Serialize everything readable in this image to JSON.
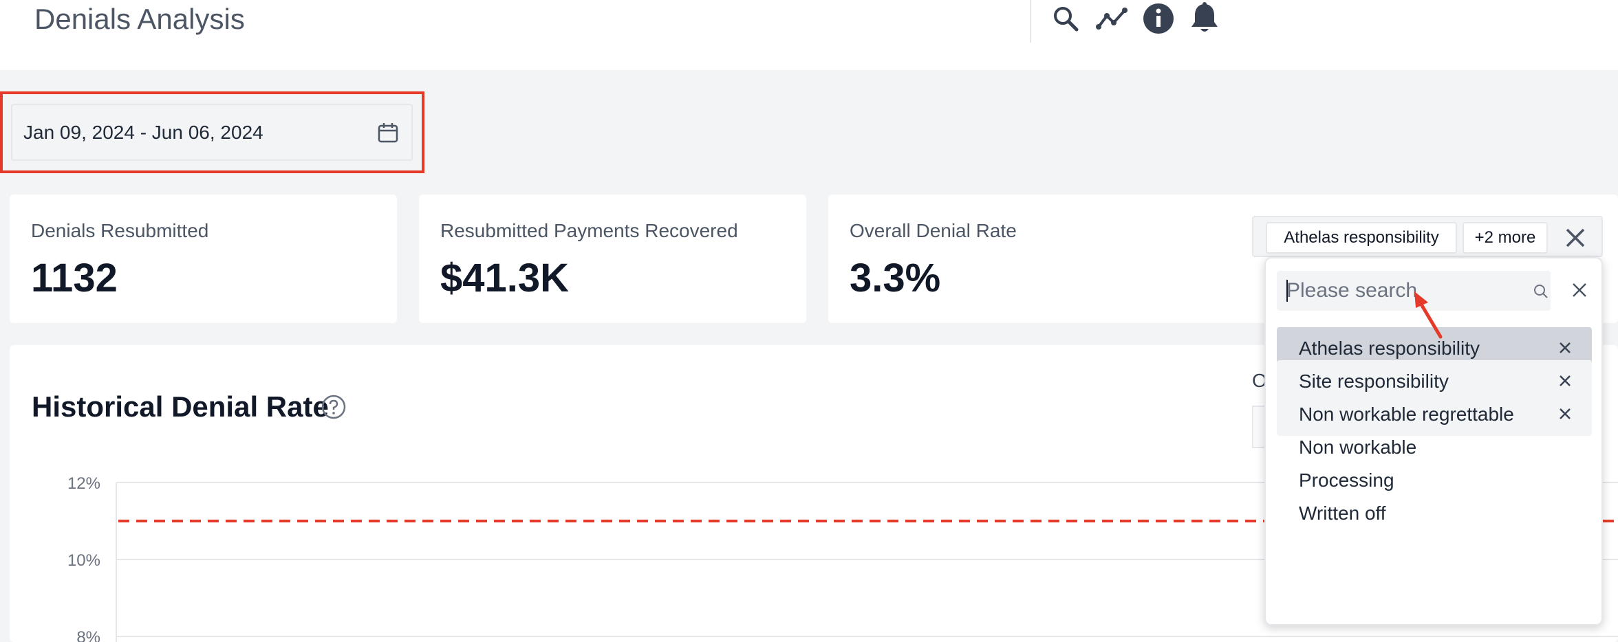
{
  "header": {
    "title": "Denials Analysis",
    "icons": [
      "search-icon",
      "trend-icon",
      "info-icon",
      "bell-icon"
    ]
  },
  "date_range": {
    "value": "Jan 09, 2024 - Jun 06, 2024"
  },
  "stats": [
    {
      "label": "Denials Resubmitted",
      "value": "1132"
    },
    {
      "label": "Resubmitted Payments Recovered",
      "value": "$41.3K"
    },
    {
      "label": "Overall Denial Rate",
      "value": "3.3%"
    }
  ],
  "filter": {
    "chips": [
      "Athelas responsibility",
      "+2 more"
    ],
    "search_placeholder": "Please search",
    "options": [
      {
        "label": "Athelas responsibility",
        "selected": true,
        "highlighted": true
      },
      {
        "label": "Site responsibility",
        "selected": true,
        "highlighted": false
      },
      {
        "label": "Non workable regrettable",
        "selected": true,
        "highlighted": false
      },
      {
        "label": "Non workable",
        "selected": false,
        "highlighted": false
      },
      {
        "label": "Processing",
        "selected": false,
        "highlighted": false
      },
      {
        "label": "Written off",
        "selected": false,
        "highlighted": false
      }
    ]
  },
  "panel": {
    "title": "Historical Denial Rate",
    "partial_label": "O"
  },
  "chart_data": {
    "type": "line",
    "title": "Historical Denial Rate",
    "y_ticks": [
      "12%",
      "10%",
      "8%"
    ],
    "ylim": [
      8,
      12
    ],
    "reference_line": {
      "value": 11,
      "style": "dashed",
      "color": "#e53a2a"
    },
    "grid": true
  },
  "colors": {
    "accent_red": "#e53a2a",
    "page_bg": "#f3f4f6",
    "selected_option_bg": "#d1d5db",
    "checked_option_bg": "#f3f4f6"
  }
}
